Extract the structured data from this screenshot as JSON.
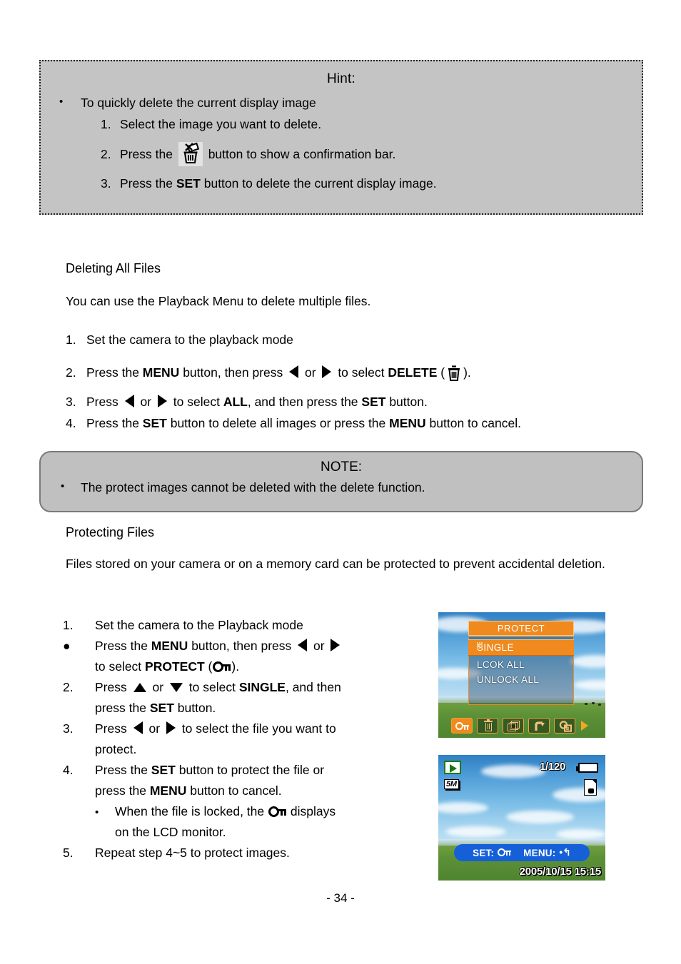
{
  "hint_box": {
    "title": "Hint:",
    "bullet": "To quickly delete the current display image",
    "steps": [
      {
        "num": "1.",
        "text": "Select the image you want to delete."
      },
      {
        "num": "2.",
        "pre": "Press the",
        "post": "button to show a confirmation bar.",
        "icon": "trash-can-icon"
      },
      {
        "num": "3.",
        "pre": "Press the",
        "key": "SET",
        "post": "button to delete the current display image."
      }
    ]
  },
  "deleting_section": {
    "heading": "Deleting All Files",
    "intro": "You can use the Playback Menu to delete multiple files.",
    "steps": [
      {
        "num": "1.",
        "t1": "Set the camera to the playback mode"
      },
      {
        "num": "2.",
        "t1": "Press the ",
        "k1": "MENU",
        "t2": " button, then press ",
        "t3": " or ",
        "t4": " to select ",
        "k2": "DELETE",
        "t5": " (",
        "t6": ")."
      },
      {
        "num": "3.",
        "t1": "Press ",
        "t2": " or ",
        "t3": " to select ",
        "k1": "ALL",
        "t4": ", and then press the ",
        "k2": "SET",
        "t5": " button."
      },
      {
        "num": "4.",
        "t1": "Press the ",
        "k1": "SET",
        "t2": " button to delete all images or press the ",
        "k2": "MENU",
        "t3": " button to cancel."
      }
    ]
  },
  "note_box": {
    "title": "NOTE:",
    "bullet": "The protect images cannot be deleted with the delete function."
  },
  "protecting_section": {
    "heading": "Protecting Files",
    "intro": "Files stored on your camera or on a memory card can be protected to prevent accidental deletion.",
    "steps": [
      {
        "num": "1.",
        "t1": "Set the camera to the Playback mode"
      },
      {
        "num": "●",
        "t1": "Press the ",
        "k1": "MENU",
        "t2": " button, then press ",
        "t3": " or ",
        "t4": "",
        "t5": "to select ",
        "k2": "PROTECT",
        "t6": " (",
        "t7": ")."
      },
      {
        "num": "2.",
        "t1": "Press ",
        "t2": " or ",
        "t3": " to select ",
        "k1": "SINGLE",
        "t4": ", and then",
        "t5": "press the ",
        "k2": "SET",
        "t6": " button."
      },
      {
        "num": "3.",
        "t1": "Press ",
        "t2": " or ",
        "t3": " to select the file you want to",
        "t4": "protect."
      },
      {
        "num": "4.",
        "t1": "Press the ",
        "k1": "SET",
        "t2": " button to protect the file or",
        "t3": "press the ",
        "k2": "MENU",
        "t4": " button to cancel."
      },
      {
        "num": "5.",
        "t1": "Repeat step 4~5 to protect images."
      }
    ],
    "sub_bullet": {
      "dot": "•",
      "t1": "When the file is locked, the ",
      "t2": " displays",
      "t3": "on the LCD monitor."
    }
  },
  "lcd_protect": {
    "menu_title": "PROTECT",
    "options": [
      {
        "label": "SINGLE",
        "selected": true
      },
      {
        "label": "LCOK ALL",
        "selected": false
      },
      {
        "label": "UNLOCK ALL",
        "selected": false
      }
    ],
    "toolbar_icons": [
      {
        "name": "protect-lock-icon",
        "active": true
      },
      {
        "name": "delete-trash-icon",
        "active": false
      },
      {
        "name": "slideshow-icon",
        "active": false
      },
      {
        "name": "rotate-icon",
        "active": false
      },
      {
        "name": "copy-to-card-icon",
        "active": false
      }
    ],
    "next_arrow": "chevron-right-icon"
  },
  "lcd_playback": {
    "mode_icon": "playback-mode-icon",
    "resolution": "5M",
    "shots": "1/120",
    "battery_icon": "battery-full-icon",
    "card_icon": "memory-card-icon",
    "set_label": "SET:",
    "menu_label": "MENU:",
    "menu_glyph": "•↰",
    "date": "2005/10/15  15:15"
  },
  "colors": {
    "box_gray": "#c4c4c4",
    "note_gray": "#c0c0c0",
    "menu_orange": "#f08a1e",
    "lcd_blue_bar": "#1560d8",
    "sky_blue": "#4d9bd6",
    "grass_green": "#5d9137"
  },
  "footer": {
    "page": "- 34 -"
  }
}
